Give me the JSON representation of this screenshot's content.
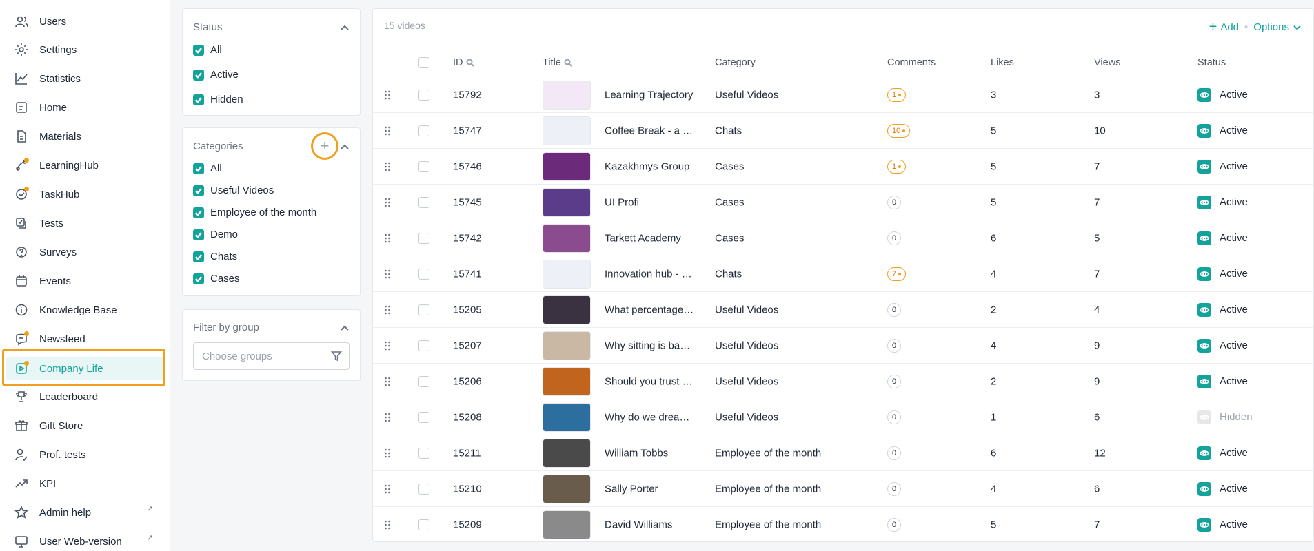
{
  "sidebar": {
    "items": [
      {
        "label": "Users",
        "icon": "users-icon"
      },
      {
        "label": "Settings",
        "icon": "gear-icon"
      },
      {
        "label": "Statistics",
        "icon": "chart-line-icon"
      },
      {
        "label": "Home",
        "icon": "home-icon"
      },
      {
        "label": "Materials",
        "icon": "document-icon"
      },
      {
        "label": "LearningHub",
        "icon": "learninghub-icon"
      },
      {
        "label": "TaskHub",
        "icon": "taskhub-icon"
      },
      {
        "label": "Tests",
        "icon": "tests-icon"
      },
      {
        "label": "Surveys",
        "icon": "survey-icon"
      },
      {
        "label": "Events",
        "icon": "events-icon"
      },
      {
        "label": "Knowledge Base",
        "icon": "info-icon"
      },
      {
        "label": "Newsfeed",
        "icon": "newsfeed-icon"
      },
      {
        "label": "Company Life",
        "icon": "video-icon"
      },
      {
        "label": "Leaderboard",
        "icon": "trophy-icon"
      },
      {
        "label": "Gift Store",
        "icon": "gift-icon"
      },
      {
        "label": "Prof. tests",
        "icon": "user-check-icon"
      },
      {
        "label": "KPI",
        "icon": "trend-icon"
      },
      {
        "label": "Admin help",
        "icon": "star-icon"
      },
      {
        "label": "User Web-version",
        "icon": "monitor-icon"
      }
    ],
    "external_marker": "↗"
  },
  "filters": {
    "status": {
      "title": "Status",
      "options": [
        "All",
        "Active",
        "Hidden"
      ]
    },
    "categories": {
      "title": "Categories",
      "add_symbol": "+",
      "options": [
        "All",
        "Useful Videos",
        "Employee of the month",
        "Demo",
        "Chats",
        "Cases"
      ]
    },
    "group": {
      "title": "Filter by group",
      "placeholder": "Choose groups"
    }
  },
  "table": {
    "count_label": "15 videos",
    "add_label": "Add",
    "add_symbol": "+",
    "separator": "•",
    "options_label": "Options",
    "columns": [
      "ID",
      "Title",
      "Category",
      "Comments",
      "Likes",
      "Views",
      "Status"
    ],
    "rows": [
      {
        "id": "15792",
        "title": "Learning Trajectory",
        "category": "Useful Videos",
        "comments": "1",
        "comments_hot": true,
        "likes": "3",
        "views": "3",
        "status": "Active",
        "thumb": "#f3e8f5"
      },
      {
        "id": "15747",
        "title": "Coffee Break - a ch…",
        "category": "Chats",
        "comments": "10",
        "comments_hot": true,
        "likes": "5",
        "views": "10",
        "status": "Active",
        "thumb": "#eef0f7"
      },
      {
        "id": "15746",
        "title": "Kazakhmys Group",
        "category": "Cases",
        "comments": "1",
        "comments_hot": true,
        "likes": "5",
        "views": "7",
        "status": "Active",
        "thumb": "#6b2b7a"
      },
      {
        "id": "15745",
        "title": "UI Profi",
        "category": "Cases",
        "comments": "0",
        "comments_hot": false,
        "likes": "5",
        "views": "7",
        "status": "Active",
        "thumb": "#5a3c8a"
      },
      {
        "id": "15742",
        "title": "Tarkett Academy",
        "category": "Cases",
        "comments": "0",
        "comments_hot": false,
        "likes": "6",
        "views": "5",
        "status": "Active",
        "thumb": "#8a4b8f"
      },
      {
        "id": "15741",
        "title": "Innovation hub - a …",
        "category": "Chats",
        "comments": "7",
        "comments_hot": true,
        "likes": "4",
        "views": "7",
        "status": "Active",
        "thumb": "#eef0f7"
      },
      {
        "id": "15205",
        "title": "What percentage o…",
        "category": "Useful Videos",
        "comments": "0",
        "comments_hot": false,
        "likes": "2",
        "views": "4",
        "status": "Active",
        "thumb": "#3a3240"
      },
      {
        "id": "15207",
        "title": "Why sitting is bad f…",
        "category": "Useful Videos",
        "comments": "0",
        "comments_hot": false,
        "likes": "4",
        "views": "9",
        "status": "Active",
        "thumb": "#c9b8a4"
      },
      {
        "id": "15206",
        "title": "Should you trust y…",
        "category": "Useful Videos",
        "comments": "0",
        "comments_hot": false,
        "likes": "2",
        "views": "9",
        "status": "Active",
        "thumb": "#c0641e"
      },
      {
        "id": "15208",
        "title": "Why do we dream?…",
        "category": "Useful Videos",
        "comments": "0",
        "comments_hot": false,
        "likes": "1",
        "views": "6",
        "status": "Hidden",
        "thumb": "#2c6f9e"
      },
      {
        "id": "15211",
        "title": "William Tobbs",
        "category": "Employee of the month",
        "comments": "0",
        "comments_hot": false,
        "likes": "6",
        "views": "12",
        "status": "Active",
        "thumb": "#4a4a4a"
      },
      {
        "id": "15210",
        "title": "Sally Porter",
        "category": "Employee of the month",
        "comments": "0",
        "comments_hot": false,
        "likes": "4",
        "views": "6",
        "status": "Active",
        "thumb": "#6a5c4c"
      },
      {
        "id": "15209",
        "title": "David Williams",
        "category": "Employee of the month",
        "comments": "0",
        "comments_hot": false,
        "likes": "5",
        "views": "7",
        "status": "Active",
        "thumb": "#8a8a8a"
      }
    ]
  },
  "colors": {
    "accent": "#14a39a",
    "highlight": "#f0a020",
    "badge": "#f59e0b"
  }
}
